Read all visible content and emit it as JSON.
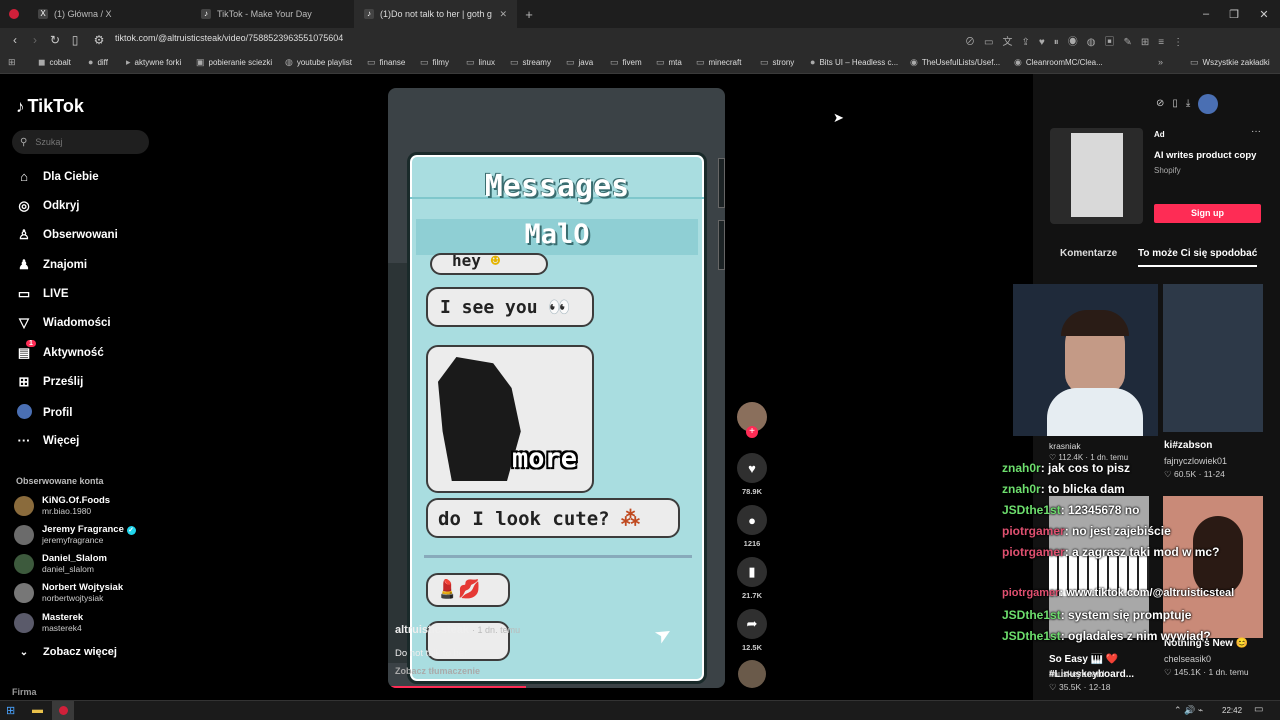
{
  "browser": {
    "tabs": [
      {
        "label": "(1) Główna / X",
        "icon": "X"
      },
      {
        "label": "TikTok - Make Your Day",
        "icon": "♪"
      },
      {
        "label": "(1)Do not talk to her | goth g",
        "icon": "♪"
      }
    ],
    "url": "tiktok.com/@altruisticsteak/video/7588523963551075604",
    "bookmarks": [
      "cobalt",
      "diff",
      "aktywne forki",
      "pobieranie sciezki",
      "youtube playlist",
      "finanse",
      "filmy",
      "linux",
      "streamy",
      "java",
      "fivem",
      "mta",
      "minecraft",
      "strony",
      "Bits UI – Headless c...",
      "TheUsefulLists/Usef...",
      "CleanroomMC/Clea...",
      "Wszystkie zakładki"
    ]
  },
  "tiktok": {
    "logo": "TikTok",
    "search_placeholder": "Szukaj",
    "nav": [
      {
        "label": "Dla Ciebie",
        "icon": "home-icon"
      },
      {
        "label": "Odkryj",
        "icon": "compass-icon"
      },
      {
        "label": "Obserwowani",
        "icon": "following-icon"
      },
      {
        "label": "Znajomi",
        "icon": "friends-icon"
      },
      {
        "label": "LIVE",
        "icon": "live-icon"
      },
      {
        "label": "Wiadomości",
        "icon": "messages-icon"
      },
      {
        "label": "Aktywność",
        "icon": "activity-icon",
        "badge": "1"
      },
      {
        "label": "Prześlij",
        "icon": "upload-icon"
      },
      {
        "label": "Profil",
        "icon": "profile-icon"
      },
      {
        "label": "Więcej",
        "icon": "more-icon"
      }
    ],
    "following_header": "Obserwowane konta",
    "accounts": [
      {
        "name": "KiNG.Of.Foods",
        "handle": "mr.biao.1980"
      },
      {
        "name": "Jeremy Fragrance",
        "handle": "jeremyfragrance",
        "verified": true
      },
      {
        "name": "Daniel_Slalom",
        "handle": "daniel_slalom"
      },
      {
        "name": "Norbert Wojtysiak",
        "handle": "norbertwojtysiak"
      },
      {
        "name": "Masterek",
        "handle": "masterek4"
      }
    ],
    "see_more": "Zobacz więcej",
    "footer": "Firma"
  },
  "video": {
    "messages_title": "Messages",
    "contact": "MalO",
    "bubbles": [
      "hey",
      "I see you",
      "more",
      "do I look cute?"
    ],
    "author": "altruisticsteak",
    "posted": "1 dn. temu",
    "caption": "Do not talk to her",
    "translate": "Zobacz tłumaczenie",
    "likes": "78.9K",
    "comments": "1216",
    "saves": "21.7K",
    "shares": "12.5K"
  },
  "right": {
    "ad_label": "Ad",
    "ad_title": "AI writes product copy",
    "ad_brand": "Shopify",
    "ad_button": "Sign up",
    "tab_comments": "Komentarze",
    "tab_suggest": "To może Ci się spodobać",
    "cards": [
      {
        "title": "ki#zabson",
        "author": "fajnyczlowiek01",
        "likes": "60.5K",
        "date": "11-24"
      },
      {
        "title": "So Easy 🎹 ❤️ #Linuskeyboard...",
        "author": "linuskeyboard",
        "likes": "35.5K",
        "date": "12-18"
      },
      {
        "title": "Nothing's New 😊",
        "author": "chelseasik0",
        "likes": "145.1K",
        "date": "1 dn. temu"
      }
    ],
    "hidden_card": {
      "author": "krasniak",
      "likes": "112.4K",
      "date": "1 dn. temu"
    }
  },
  "stream_overlay": {
    "chat": [
      {
        "user": "znah0r",
        "text": "jak cos to pisz"
      },
      {
        "user": "znah0r",
        "text": "to blicka dam"
      },
      {
        "user": "JSDthe1st",
        "text": "12345678 no"
      },
      {
        "user": "piotrgamer",
        "text": "no jest zajebiście"
      },
      {
        "user": "piotrgamer",
        "text": "a zagrasz taki mod w mc?"
      },
      {
        "user": "piotrgamer",
        "text": "www.tiktok.com/@altruisticsteal"
      },
      {
        "user": "JSDthe1st",
        "text": "system się promptuje"
      },
      {
        "user": "JSDthe1st",
        "text": "ogladales z nim wywiad?"
      }
    ]
  },
  "taskbar": {
    "time": "22:42"
  }
}
